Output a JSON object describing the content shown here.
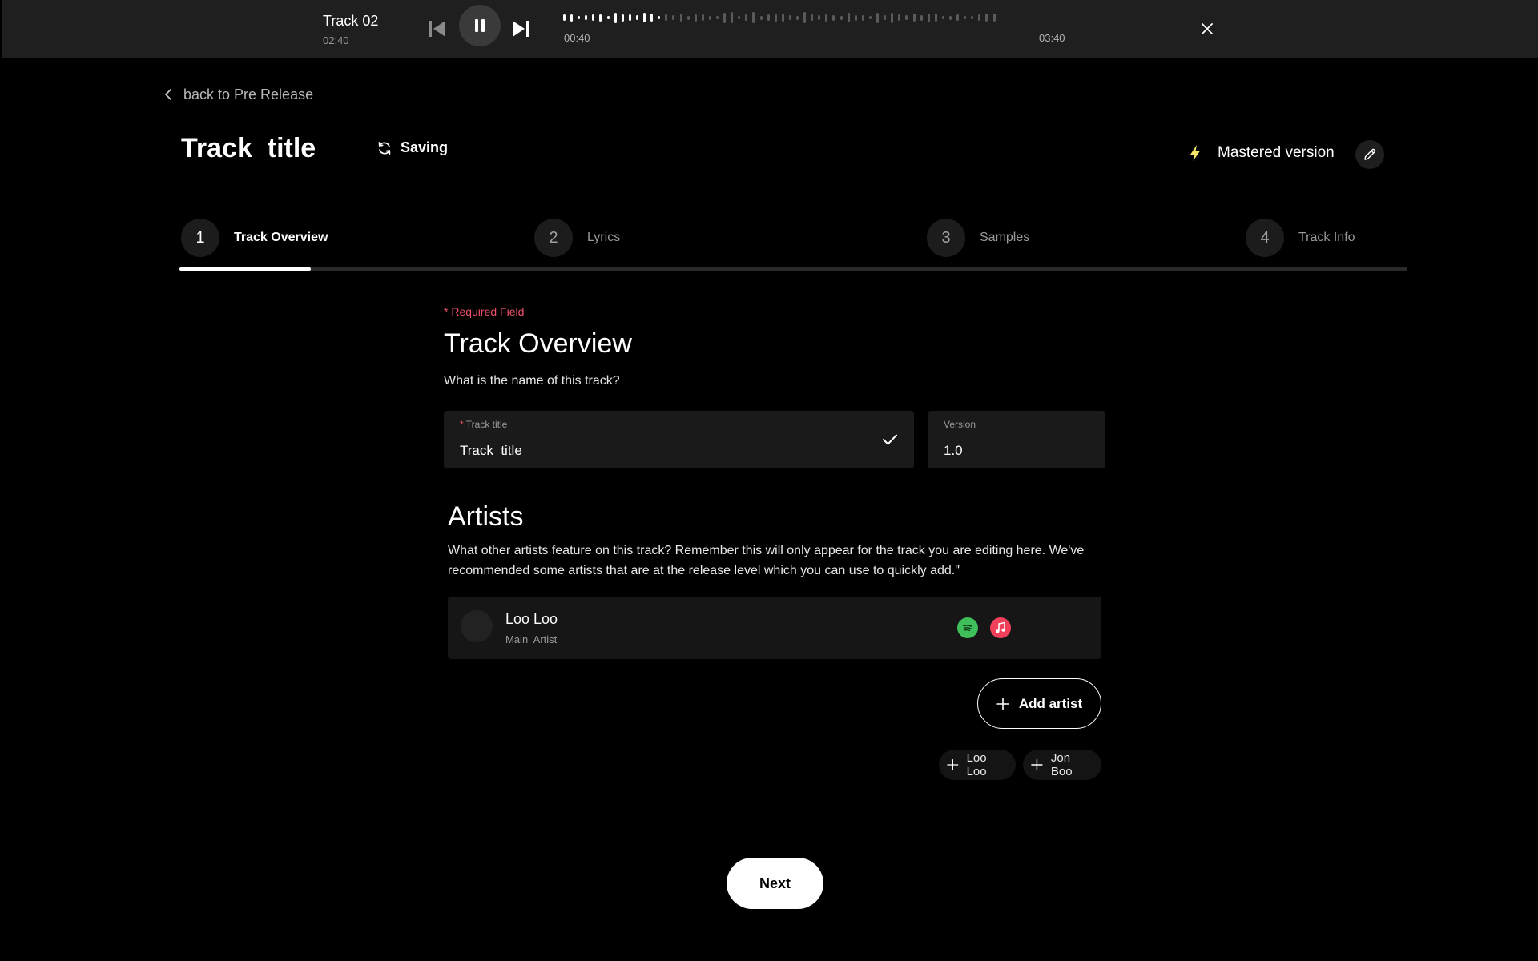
{
  "player": {
    "track_name": "Track 02",
    "duration": "02:40",
    "elapsed": "00:40",
    "total": "03:40",
    "progress_fraction": 0.23
  },
  "nav": {
    "back_label": "back to Pre Release"
  },
  "header": {
    "title": "Track  title",
    "saving_label": "Saving",
    "mastered_label": "Mastered version"
  },
  "stepper": {
    "steps": [
      {
        "num": "1",
        "label": "Track Overview",
        "active": true
      },
      {
        "num": "2",
        "label": "Lyrics",
        "active": false
      },
      {
        "num": "3",
        "label": "Samples",
        "active": false
      },
      {
        "num": "4",
        "label": "Track Info",
        "active": false
      }
    ],
    "progress_fraction": 0.107
  },
  "overview": {
    "required_note": "* Required Field",
    "title": "Track Overview",
    "question": "What is the name of this track?",
    "track_title_label_req": "*",
    "track_title_label": "Track title",
    "track_title_value": "Track  title",
    "version_label": "Version",
    "version_value": "1.0"
  },
  "artists": {
    "title": "Artists",
    "description": "What other artists feature on this track? Remember this will only appear for the track you are editing here. We've recommended some artists that are at the release level which you can use to quickly add.\"",
    "list": [
      {
        "name": "Loo Loo",
        "role": "Main  Artist"
      }
    ],
    "add_label": "Add artist",
    "suggestions": [
      "Loo Loo",
      "Jon Boo"
    ]
  },
  "footer": {
    "next_label": "Next"
  },
  "colors": {
    "accent_required": "#f0516a",
    "spotify": "#3fbf5a",
    "apple_music": "#f0405a",
    "mastered_bolt": "#f5e663"
  },
  "icons": {
    "prev": "skip-previous-icon",
    "pause": "pause-icon",
    "next": "skip-next-icon",
    "close": "close-icon",
    "back": "chevron-left-icon",
    "saving": "refresh-icon",
    "mastered": "lightning-bolt-icon",
    "edit": "pencil-icon",
    "check": "check-icon",
    "spotify": "spotify-icon",
    "apple": "apple-music-icon",
    "plus": "plus-icon"
  }
}
